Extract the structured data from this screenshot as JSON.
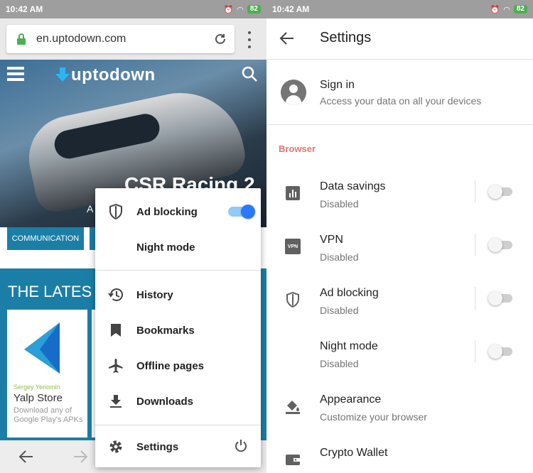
{
  "left": {
    "status": {
      "time": "10:42 AM",
      "battery": "82"
    },
    "url": "en.uptodown.com",
    "site": {
      "logo": "uptodown",
      "hero_title": "CSR Racing 2",
      "hero_sub": "A",
      "category": "COMMUNICATION",
      "latest_title": "THE LATES",
      "card": {
        "developer": "Sergey Yeriomin",
        "name": "Yalp Store",
        "desc": "Download any of Google Play's APKs"
      }
    },
    "menu": {
      "items": [
        {
          "label": "Ad blocking",
          "icon": "shield-icon"
        },
        {
          "label": "Night mode",
          "icon": "moon-icon"
        },
        {
          "label": "History",
          "icon": "history-icon"
        },
        {
          "label": "Bookmarks",
          "icon": "bookmark-icon"
        },
        {
          "label": "Offline pages",
          "icon": "airplane-icon"
        },
        {
          "label": "Downloads",
          "icon": "download-icon"
        },
        {
          "label": "Settings",
          "icon": "gear-icon"
        }
      ],
      "ad_blocking_enabled": true
    }
  },
  "right": {
    "status": {
      "time": "10:42 AM",
      "battery": "82"
    },
    "title": "Settings",
    "signin": {
      "title": "Sign in",
      "subtitle": "Access your data on all your devices"
    },
    "section": "Browser",
    "rows": [
      {
        "title": "Data savings",
        "subtitle": "Disabled",
        "icon": "bar-chart-icon",
        "toggle": false
      },
      {
        "title": "VPN",
        "subtitle": "Disabled",
        "icon": "vpn-icon",
        "icon_text": "VPN",
        "toggle": false
      },
      {
        "title": "Ad blocking",
        "subtitle": "Disabled",
        "icon": "shield-icon",
        "toggle": false
      },
      {
        "title": "Night mode",
        "subtitle": "Disabled",
        "icon": "moon-icon",
        "toggle": false
      },
      {
        "title": "Appearance",
        "subtitle": "Customize your browser",
        "icon": "paint-bucket-icon"
      },
      {
        "title": "Crypto Wallet",
        "subtitle": "",
        "icon": "wallet-icon"
      }
    ]
  },
  "colors": {
    "accent_blue": "#2979ff",
    "site_blue": "#1b7ea6",
    "section_red": "#e57373",
    "lock_green": "#4caf50"
  }
}
